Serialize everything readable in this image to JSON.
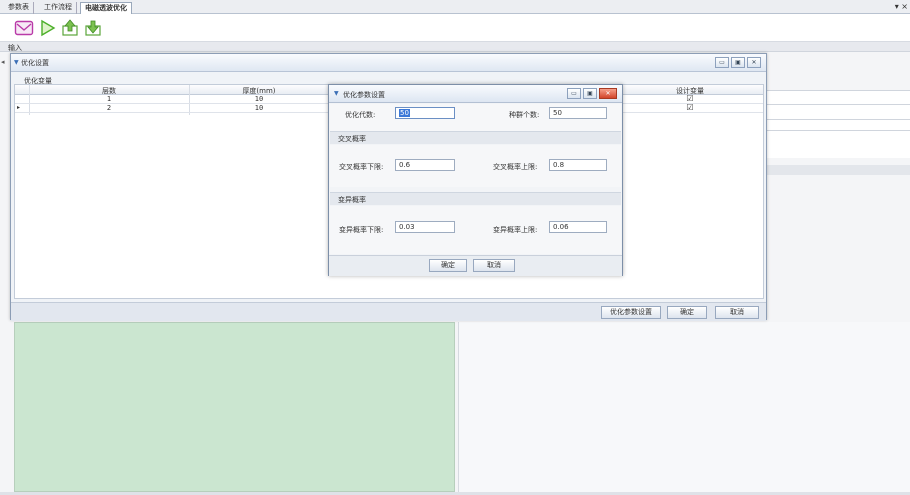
{
  "tabs": [
    {
      "label": "参数表"
    },
    {
      "label": "工作流程"
    },
    {
      "label": "电磁透波优化"
    }
  ],
  "tab_menu_glyph": "▾ ×",
  "toolbar": {
    "icons": [
      "envelope-icon",
      "play-icon",
      "export-icon",
      "import-icon"
    ]
  },
  "section": {
    "label": "输入"
  },
  "dialog_main": {
    "title": "优化设置",
    "group_label": "优化变量",
    "window_buttons": [
      "▭",
      "▣",
      "✕"
    ],
    "columns": [
      "层数",
      "厚度(mm)",
      "设计变量"
    ],
    "rows": [
      {
        "selector": "",
        "layer": "1",
        "thickness": "10",
        "design_var": "☑"
      },
      {
        "selector": "▸",
        "layer": "2",
        "thickness": "10",
        "design_var": "☑"
      }
    ],
    "buttons": {
      "opt_params": "优化参数设置",
      "ok": "确定",
      "cancel": "取消"
    }
  },
  "dialog_params": {
    "title": "优化参数设置",
    "window_buttons": [
      "▭",
      "▣",
      "✕"
    ],
    "generations_label": "优化代数:",
    "generations_value": "50",
    "population_label": "种群个数:",
    "population_value": "50",
    "crossover_section": "交叉概率",
    "crossover_low_label": "交叉概率下限:",
    "crossover_low_value": "0.6",
    "crossover_high_label": "交叉概率上限:",
    "crossover_high_value": "0.8",
    "mutation_section": "变异概率",
    "mutation_low_label": "变异概率下限:",
    "mutation_low_value": "0.03",
    "mutation_high_label": "变异概率上限:",
    "mutation_high_value": "0.06",
    "buttons": {
      "ok": "确定",
      "cancel": "取消"
    }
  },
  "colors": {
    "accent": "#3b78d8",
    "green_panel": "#cbe6d0",
    "close_button": "#d2452a"
  }
}
